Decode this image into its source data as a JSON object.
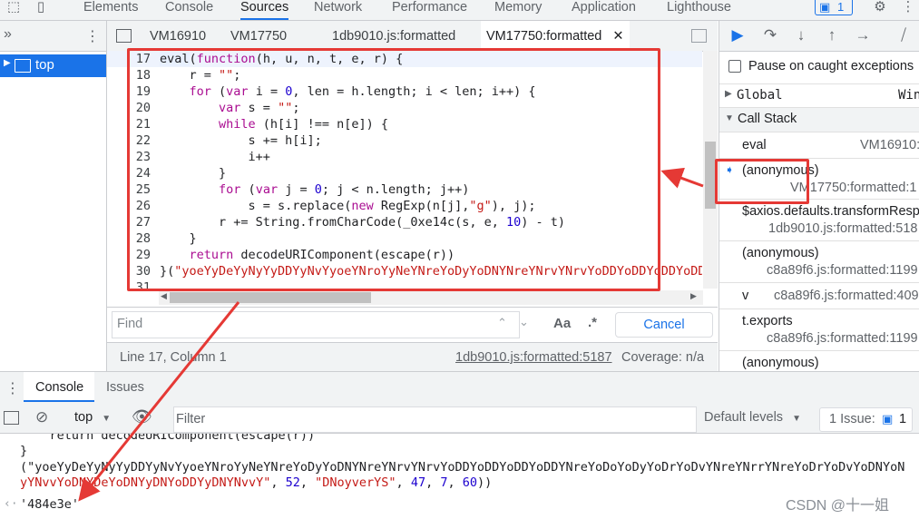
{
  "devtools": {
    "tabs": [
      "Elements",
      "Console",
      "Sources",
      "Network",
      "Performance",
      "Memory",
      "Application",
      "Lighthouse"
    ],
    "active_tab": "Sources",
    "issue_count": "1"
  },
  "navigator": {
    "top_label": "top"
  },
  "editor": {
    "tabs": [
      "VM16910",
      "VM17750",
      "1db9010.js:formatted",
      "VM17750:formatted"
    ],
    "active_tab": "VM17750:formatted",
    "lines": [
      {
        "n": "17",
        "parts": [
          {
            "t": "eval",
            "c": "hl"
          },
          {
            "t": "(",
            "c": ""
          },
          {
            "t": "function",
            "c": "kw"
          },
          {
            "t": "(h, u, n, t, e, r) {",
            "c": ""
          }
        ]
      },
      {
        "n": "18",
        "parts": [
          {
            "t": "    r = ",
            "c": ""
          },
          {
            "t": "\"\"",
            "c": "str"
          },
          {
            "t": ";",
            "c": ""
          }
        ]
      },
      {
        "n": "19",
        "parts": [
          {
            "t": "    ",
            "c": ""
          },
          {
            "t": "for",
            "c": "kw"
          },
          {
            "t": " (",
            "c": ""
          },
          {
            "t": "var",
            "c": "kw"
          },
          {
            "t": " i = ",
            "c": ""
          },
          {
            "t": "0",
            "c": "num"
          },
          {
            "t": ", len = h.length; i < len; i++) {",
            "c": ""
          }
        ]
      },
      {
        "n": "20",
        "parts": [
          {
            "t": "        ",
            "c": ""
          },
          {
            "t": "var",
            "c": "kw"
          },
          {
            "t": " s = ",
            "c": ""
          },
          {
            "t": "\"\"",
            "c": "str"
          },
          {
            "t": ";",
            "c": ""
          }
        ]
      },
      {
        "n": "21",
        "parts": [
          {
            "t": "        ",
            "c": ""
          },
          {
            "t": "while",
            "c": "kw"
          },
          {
            "t": " (h[i] !== n[e]) {",
            "c": ""
          }
        ]
      },
      {
        "n": "22",
        "parts": [
          {
            "t": "            s += h[i];",
            "c": ""
          }
        ]
      },
      {
        "n": "23",
        "parts": [
          {
            "t": "            i++",
            "c": ""
          }
        ]
      },
      {
        "n": "24",
        "parts": [
          {
            "t": "        }",
            "c": ""
          }
        ]
      },
      {
        "n": "25",
        "parts": [
          {
            "t": "        ",
            "c": ""
          },
          {
            "t": "for",
            "c": "kw"
          },
          {
            "t": " (",
            "c": ""
          },
          {
            "t": "var",
            "c": "kw"
          },
          {
            "t": " j = ",
            "c": ""
          },
          {
            "t": "0",
            "c": "num"
          },
          {
            "t": "; j < n.length; j++)",
            "c": ""
          }
        ]
      },
      {
        "n": "26",
        "parts": [
          {
            "t": "            s = s.replace(",
            "c": ""
          },
          {
            "t": "new",
            "c": "kw"
          },
          {
            "t": " RegExp(n[j],",
            "c": ""
          },
          {
            "t": "\"g\"",
            "c": "str"
          },
          {
            "t": "), j);",
            "c": ""
          }
        ]
      },
      {
        "n": "27",
        "parts": [
          {
            "t": "        r += String.fromCharCode(_0xe14c(s, e, ",
            "c": ""
          },
          {
            "t": "10",
            "c": "num"
          },
          {
            "t": ") - t)",
            "c": ""
          }
        ]
      },
      {
        "n": "28",
        "parts": [
          {
            "t": "    }",
            "c": ""
          }
        ]
      },
      {
        "n": "29",
        "parts": [
          {
            "t": "    ",
            "c": ""
          },
          {
            "t": "return",
            "c": "kw"
          },
          {
            "t": " decodeURIComponent(escape(r))",
            "c": ""
          }
        ]
      },
      {
        "n": "30",
        "parts": [
          {
            "t": "}(",
            "c": ""
          },
          {
            "t": "\"yoeYyDeYyNyYyDDYyNvYyoeYNroYyNeYNreYoDyYoDNYNreYNrvYNrvYoDDYoDDYoDDYoDDYNreYoDoYoDyYoDrYoDvYNreYNrrYNreYoDrYoDvYoDNYoNvYyNvvYoDNYDeYoDNYyDNYoDDYyDNYNvvY\"",
            "c": "str"
          }
        ]
      },
      {
        "n": "31",
        "parts": []
      }
    ]
  },
  "find": {
    "placeholder": "Find",
    "aa_label": "Aa",
    "regex_label": ".*",
    "cancel_label": "Cancel"
  },
  "status": {
    "position": "Line 17, Column 1",
    "source_link": "1db9010.js:formatted:5187",
    "coverage": "Coverage: n/a"
  },
  "debugger": {
    "pause_label": "Pause on caught exceptions",
    "global_label": "Global",
    "global_value": "Win",
    "callstack_label": "Call Stack",
    "frames": [
      {
        "name": "eval",
        "loc": "VM16910:"
      },
      {
        "name": "(anonymous)",
        "loc": "VM17750:formatted:1"
      },
      {
        "name": "$axios.defaults.transformResp",
        "loc": "1db9010.js:formatted:518"
      },
      {
        "name": "(anonymous)",
        "loc": "c8a89f6.js:formatted:1199"
      },
      {
        "name": "v",
        "loc": "c8a89f6.js:formatted:409"
      },
      {
        "name": "t.exports",
        "loc": "c8a89f6.js:formatted:1199"
      },
      {
        "name": "(anonymous)",
        "loc": ""
      }
    ]
  },
  "drawer": {
    "tabs": [
      "Console",
      "Issues"
    ],
    "active_tab": "Console",
    "context": "top",
    "filter_placeholder": "Filter",
    "levels_label": "Default levels",
    "issues_label": "1 Issue:",
    "issues_count": "1"
  },
  "console": {
    "lines": [
      {
        "t": "    return decodeURIComponent(escape(r))",
        "c": ""
      },
      {
        "t": "}",
        "c": ""
      },
      {
        "t": "(\"yoeYyDeYyNyYyDDYyNvYyoeYNroYyNeYNreYoDyYoDNYNreYNrvYNrvYoDDYoDDYoDDYoDDYNreYoDoYoDyYoDrYoDvYNreYNrrYNreYoDrYoDvYoDNYoN",
        "c": "str"
      },
      {
        "t": "yYNvvYoDNYDeYoDNYyDNYoDDYyDNYNvvY\", 52, \"DNoyverYS\", 47, 7, 60))",
        "c": "mixed"
      }
    ],
    "result": "'484e3e'"
  },
  "watermark": "CSDN @十一姐"
}
